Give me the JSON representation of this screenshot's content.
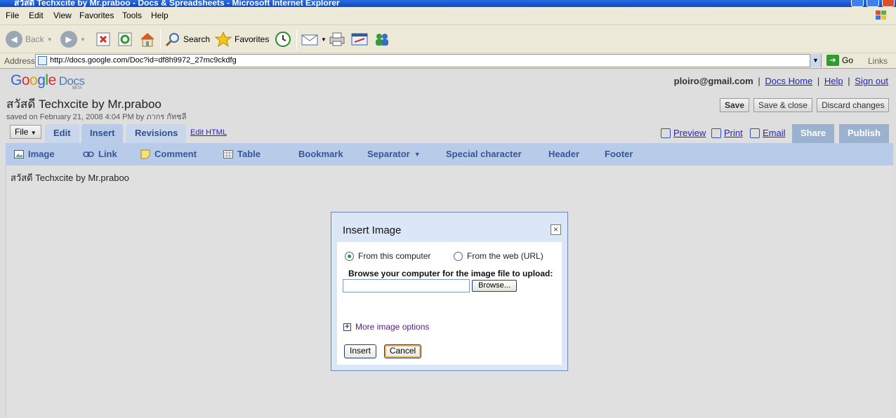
{
  "window": {
    "title": "สวัสดี Techxcite by Mr.praboo - Docs & Spreadsheets - Microsoft Internet Explorer"
  },
  "menu": [
    "File",
    "Edit",
    "View",
    "Favorites",
    "Tools",
    "Help"
  ],
  "toolbar": {
    "back": "Back",
    "search": "Search",
    "favorites": "Favorites"
  },
  "address": {
    "label": "Address",
    "url": "http://docs.google.com/Doc?id=df8h9972_27mc9ckdfg",
    "go": "Go",
    "links": "Links"
  },
  "docs": {
    "logo_g": "G",
    "logo_o1": "o",
    "logo_o2": "o",
    "logo_g2": "g",
    "logo_l": "l",
    "logo_e": "e",
    "logo_docs": "Docs",
    "logo_beta": "BETA",
    "user_email": "ploiro@gmail.com",
    "docs_home": "Docs Home",
    "help": "Help",
    "sign_out": "Sign out",
    "doc_title": "สวัสดี Techxcite by Mr.praboo",
    "saved": "saved on February 21, 2008 4:04 PM by ภากร กัทชลี",
    "buttons": {
      "save": "Save",
      "save_close": "Save & close",
      "discard": "Discard changes"
    },
    "file_menu": "File",
    "tabs": {
      "edit": "Edit",
      "insert": "Insert",
      "revisions": "Revisions"
    },
    "edit_html": "Edit HTML",
    "preview": "Preview",
    "print": "Print",
    "email": "Email",
    "share": "Share",
    "publish": "Publish",
    "insert_items": {
      "image": "Image",
      "link": "Link",
      "comment": "Comment",
      "table": "Table",
      "bookmark": "Bookmark",
      "separator": "Separator",
      "special_character": "Special character",
      "header": "Header",
      "footer": "Footer"
    },
    "body_text": "สวัสดี Techxcite by Mr.praboo"
  },
  "dialog": {
    "title": "Insert Image",
    "close": "×",
    "from_computer": "From this computer",
    "from_web": "From the web (URL)",
    "selected_source": "From this computer",
    "browse_label": "Browse your computer for the image file to upload:",
    "file_value": "",
    "browse_button": "Browse...",
    "more_options": "More image options",
    "more_options_icon": "+",
    "insert": "Insert",
    "cancel": "Cancel"
  }
}
